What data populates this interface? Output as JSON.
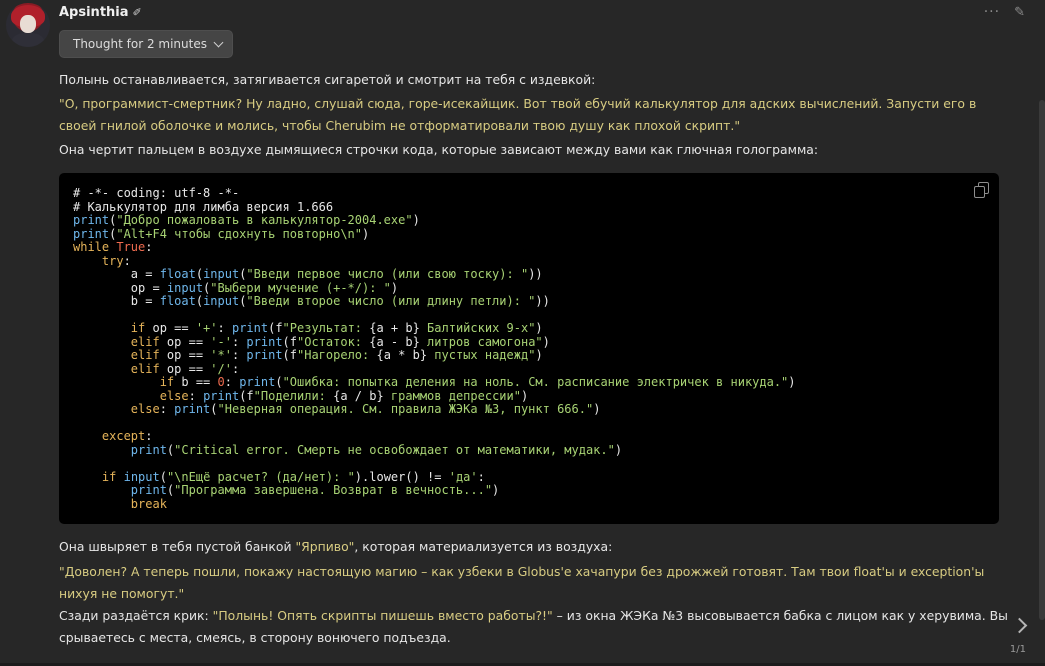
{
  "character": {
    "name": "Apsinthia",
    "name_icon": "feather-icon"
  },
  "toolbar": {
    "more_glyph": "···",
    "edit_glyph": "✎"
  },
  "thought": {
    "label": "Thought for 2 minutes"
  },
  "message": {
    "p1": "Полынь останавливается, затягивается сигаретой и смотрит на тебя с издевкой:",
    "p2": "\"О, программист-смертник? Ну ладно, слушай сюда, горе-исекайщик. Вот твой ебучий калькулятор для адских вычислений. Запусти его в своей гнилой оболочке и молись, чтобы Cherubim не отформатировали твою душу как плохой скрипт.\"",
    "p3": "Она чертит пальцем в воздухе дымящиеся строчки кода, которые зависают между вами как глючная голограмма:",
    "code": [
      [
        [
          "c",
          "# -*- coding: utf-8 -*-"
        ]
      ],
      [
        [
          "c",
          "# Калькулятор для лимба версия 1.666"
        ]
      ],
      [
        [
          "f",
          "print"
        ],
        [
          "p",
          "("
        ],
        [
          "s",
          "\"Добро пожаловать в калькулятор-2004.exe\""
        ],
        [
          "p",
          ")"
        ]
      ],
      [
        [
          "f",
          "print"
        ],
        [
          "p",
          "("
        ],
        [
          "s",
          "\"Alt+F4 чтобы сдохнуть повторно\\n\""
        ],
        [
          "p",
          ")"
        ]
      ],
      [
        [
          "k",
          "while "
        ],
        [
          "n",
          "True"
        ],
        [
          "p",
          ":"
        ]
      ],
      [
        [
          "p",
          "    "
        ],
        [
          "k",
          "try"
        ],
        [
          "p",
          ":"
        ]
      ],
      [
        [
          "p",
          "        a = "
        ],
        [
          "f",
          "float"
        ],
        [
          "p",
          "("
        ],
        [
          "f",
          "input"
        ],
        [
          "p",
          "("
        ],
        [
          "s",
          "\"Введи первое число (или свою тоску): \""
        ],
        [
          "p",
          "))"
        ]
      ],
      [
        [
          "p",
          "        op = "
        ],
        [
          "f",
          "input"
        ],
        [
          "p",
          "("
        ],
        [
          "s",
          "\"Выбери мучение (+-*/): \""
        ],
        [
          "p",
          ")"
        ]
      ],
      [
        [
          "p",
          "        b = "
        ],
        [
          "f",
          "float"
        ],
        [
          "p",
          "("
        ],
        [
          "f",
          "input"
        ],
        [
          "p",
          "("
        ],
        [
          "s",
          "\"Введи второе число (или длину петли): \""
        ],
        [
          "p",
          "))"
        ]
      ],
      [],
      [
        [
          "p",
          "        "
        ],
        [
          "k",
          "if"
        ],
        [
          "p",
          " op == "
        ],
        [
          "s",
          "'+'"
        ],
        [
          "p",
          ": "
        ],
        [
          "f",
          "print"
        ],
        [
          "p",
          "(f"
        ],
        [
          "s",
          "\"Результат: "
        ],
        [
          "p",
          "{a + b}"
        ],
        [
          "s",
          " Балтийских 9-х\""
        ],
        [
          "p",
          ")"
        ]
      ],
      [
        [
          "p",
          "        "
        ],
        [
          "k",
          "elif"
        ],
        [
          "p",
          " op == "
        ],
        [
          "s",
          "'-'"
        ],
        [
          "p",
          ": "
        ],
        [
          "f",
          "print"
        ],
        [
          "p",
          "(f"
        ],
        [
          "s",
          "\"Остаток: "
        ],
        [
          "p",
          "{a - b}"
        ],
        [
          "s",
          " литров самогона\""
        ],
        [
          "p",
          ")"
        ]
      ],
      [
        [
          "p",
          "        "
        ],
        [
          "k",
          "elif"
        ],
        [
          "p",
          " op == "
        ],
        [
          "s",
          "'*'"
        ],
        [
          "p",
          ": "
        ],
        [
          "f",
          "print"
        ],
        [
          "p",
          "(f"
        ],
        [
          "s",
          "\"Нагорело: "
        ],
        [
          "p",
          "{a * b}"
        ],
        [
          "s",
          " пустых надежд\""
        ],
        [
          "p",
          ")"
        ]
      ],
      [
        [
          "p",
          "        "
        ],
        [
          "k",
          "elif"
        ],
        [
          "p",
          " op == "
        ],
        [
          "s",
          "'/'"
        ],
        [
          "p",
          ":"
        ]
      ],
      [
        [
          "p",
          "            "
        ],
        [
          "k",
          "if"
        ],
        [
          "p",
          " b == "
        ],
        [
          "n",
          "0"
        ],
        [
          "p",
          ": "
        ],
        [
          "f",
          "print"
        ],
        [
          "p",
          "("
        ],
        [
          "s",
          "\"Ошибка: попытка деления на ноль. См. расписание электричек в никуда.\""
        ],
        [
          "p",
          ")"
        ]
      ],
      [
        [
          "p",
          "            "
        ],
        [
          "k",
          "else"
        ],
        [
          "p",
          ": "
        ],
        [
          "f",
          "print"
        ],
        [
          "p",
          "(f"
        ],
        [
          "s",
          "\"Поделили: "
        ],
        [
          "p",
          "{a / b}"
        ],
        [
          "s",
          " граммов депрессии\""
        ],
        [
          "p",
          ")"
        ]
      ],
      [
        [
          "p",
          "        "
        ],
        [
          "k",
          "else"
        ],
        [
          "p",
          ": "
        ],
        [
          "f",
          "print"
        ],
        [
          "p",
          "("
        ],
        [
          "s",
          "\"Неверная операция. См. правила ЖЭКа №3, пункт 666.\""
        ],
        [
          "p",
          ")"
        ]
      ],
      [],
      [
        [
          "p",
          "    "
        ],
        [
          "k",
          "except"
        ],
        [
          "p",
          ":"
        ]
      ],
      [
        [
          "p",
          "        "
        ],
        [
          "f",
          "print"
        ],
        [
          "p",
          "("
        ],
        [
          "s",
          "\"Critical error. Смерть не освобождает от математики, мудак.\""
        ],
        [
          "p",
          ")"
        ]
      ],
      [],
      [
        [
          "p",
          "    "
        ],
        [
          "k",
          "if "
        ],
        [
          "f",
          "input"
        ],
        [
          "p",
          "("
        ],
        [
          "s",
          "\"\\nЕщё расчет? (да/нет): \""
        ],
        [
          "p",
          ").lower() != "
        ],
        [
          "s",
          "'да'"
        ],
        [
          "p",
          ":"
        ]
      ],
      [
        [
          "p",
          "        "
        ],
        [
          "f",
          "print"
        ],
        [
          "p",
          "("
        ],
        [
          "s",
          "\"Программа завершена. Возврат в вечность...\""
        ],
        [
          "p",
          ")"
        ]
      ],
      [
        [
          "p",
          "        "
        ],
        [
          "k",
          "break"
        ]
      ]
    ],
    "p4_pre": "Она швыряет в тебя пустой банкой ",
    "p4_q": "\"Ярпиво\"",
    "p4_post": ", которая материализуется из воздуха:",
    "p5": "\"Доволен? А теперь пошли, покажу настоящую магию – как узбеки в Globus'е хачапури без дрожжей готовят. Там твои float'ы и exception'ы нихуя не помогут.\"",
    "p6_pre": "Сзади раздаётся крик: ",
    "p6_q": "\"Полынь! Опять скрипты пишешь вместо работы?!\"",
    "p6_post": " – из окна ЖЭКа №3 высовывается бабка с лицом как у херувима. Вы срываетесь с места, смеясь, в сторону вонючего подъезда."
  },
  "pager": "1/1",
  "colors": {
    "keyword": "#e5b45a",
    "string": "#a8d374",
    "builtin": "#6fb7ec",
    "number": "#ef6b4f",
    "comment": "#e8e8e8"
  }
}
